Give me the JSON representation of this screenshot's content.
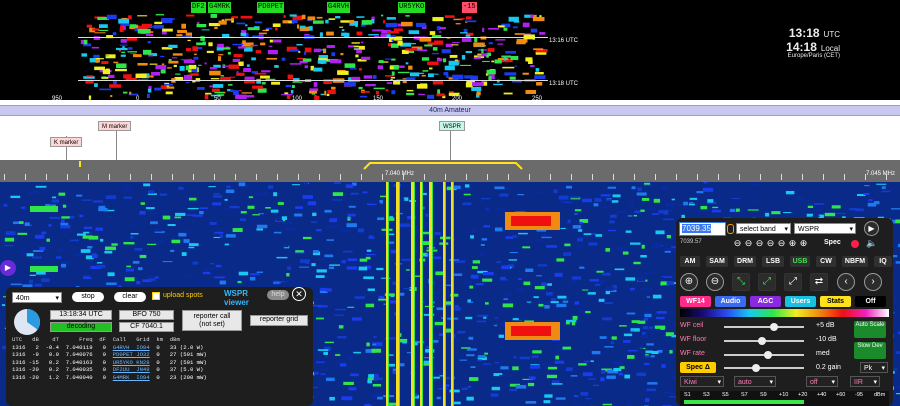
{
  "top_waterfall": {
    "spots": [
      {
        "label": "DF2",
        "color": "#22dd22"
      },
      {
        "label": "G4MRK",
        "color": "#22dd22"
      },
      {
        "label": "PD0PET",
        "color": "#22dd22"
      },
      {
        "label": "G4RVH",
        "color": "#22dd22"
      },
      {
        "label": "UR5YKO",
        "color": "#22dd22"
      },
      {
        "label": "-15",
        "color": "#ff4d6a"
      }
    ],
    "utc_marks": [
      "13:16 UTC",
      "13:18 UTC"
    ],
    "x_ticks": [
      "950",
      "0",
      "50",
      "100",
      "150",
      "200",
      "250"
    ],
    "clock": {
      "utc_time": "13:18",
      "utc_label": "UTC",
      "local_time": "14:18",
      "local_label": "Local",
      "timezone": "Europe/Paris (CET)"
    }
  },
  "band_bar": {
    "label": "40m Amateur"
  },
  "markers": [
    {
      "label": "K marker",
      "color": "#ffd6d6"
    },
    {
      "label": "M marker",
      "color": "#ffd6d6"
    },
    {
      "label": "WSPR",
      "color": "#c6f7e8"
    }
  ],
  "scale": {
    "labels": [
      "7.040 MHz",
      "7.045 MHz"
    ]
  },
  "wspr_panel": {
    "band": "40m",
    "stop_label": "stop",
    "clear_label": "clear",
    "upload_label": "upload spots",
    "upload_checked": false,
    "title": "WSPR viewer",
    "help_label": "help",
    "time": "13:18:34 UTC",
    "status": "decoding",
    "bfo": "BFO 750",
    "cf": "CF 7040.1",
    "reporter_call": "reporter call",
    "reporter_call_value": "(not set)",
    "reporter_grid": "reporter grid",
    "progress": 0.35,
    "table_header": [
      "UTC",
      "dB",
      "dT",
      "Freq",
      "dF",
      "Call",
      "Grid",
      "km",
      "dBm"
    ],
    "rows": [
      {
        "utc": "1316",
        "db": "2",
        "dt": "-0.4",
        "freq": "7.040119",
        "df": "0",
        "call": "G4RVH",
        "grid": "IO94",
        "km": "0",
        "dbm": "33 (2.0 W)"
      },
      {
        "utc": "1316",
        "db": "-9",
        "dt": "0.0",
        "freq": "7.040076",
        "df": "0",
        "call": "PD0PET",
        "grid": "JO32",
        "km": "0",
        "dbm": "27 (501 mW)"
      },
      {
        "utc": "1316",
        "db": "-15",
        "dt": "0.2",
        "freq": "7.040163",
        "df": "0",
        "call": "UR5YKO",
        "grid": "KN28",
        "km": "0",
        "dbm": "27 (501 mW)"
      },
      {
        "utc": "1316",
        "db": "-20",
        "dt": "0.2",
        "freq": "7.040035",
        "df": "0",
        "call": "DF2UU",
        "grid": "JN48",
        "km": "0",
        "dbm": "37 (5.0 W)"
      },
      {
        "utc": "1316",
        "db": "-20",
        "dt": "1.2",
        "freq": "7.040040",
        "df": "0",
        "call": "G4MRK",
        "grid": "IO94",
        "km": "0",
        "dbm": "23 (200 mW)"
      }
    ]
  },
  "control_panel": {
    "frequency": "7039.35",
    "freq_sub": "7039.57",
    "band_select": "select band",
    "mode_select": "WSPR",
    "spec_label": "Spec",
    "modes": [
      "AM",
      "SAM",
      "DRM",
      "LSB",
      "USB",
      "CW",
      "NBFM",
      "IQ"
    ],
    "active_mode": "USB",
    "tabs": [
      "WF14",
      "Audio",
      "AGC",
      "Users",
      "Stats",
      "Off"
    ],
    "sliders": [
      {
        "label": "WF ceil",
        "value": "+5 dB",
        "pos": 0.62
      },
      {
        "label": "WF floor",
        "value": "-10 dB",
        "pos": 0.48
      },
      {
        "label": "WF rate",
        "value": "med",
        "pos": 0.55
      }
    ],
    "auto_scale": "Auto Scale",
    "slow_dev": "Slow Dev",
    "spec_delta": "Spec Δ",
    "gain_value": "0.2 gain",
    "pk_select": "Pk",
    "bottom_selects": [
      "Kiwi",
      "auto",
      "off",
      "IIR"
    ],
    "s_meter": [
      "S1",
      "S3",
      "S5",
      "S7",
      "S9",
      "+10",
      "+20",
      "+40",
      "+60",
      "-95",
      "dBm"
    ]
  }
}
